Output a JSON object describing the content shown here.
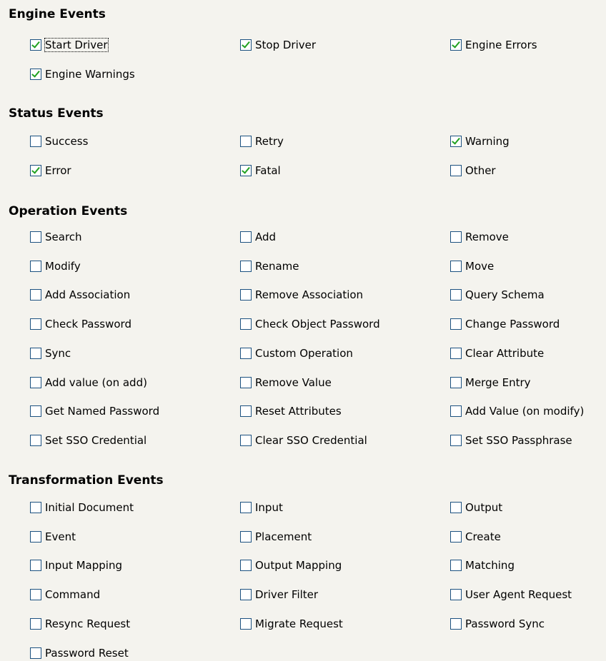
{
  "sections": [
    {
      "title": "Engine Events",
      "items": [
        {
          "label": "Start Driver",
          "checked": true
        },
        {
          "label": "Stop Driver",
          "checked": true
        },
        {
          "label": "Engine Errors",
          "checked": true
        },
        {
          "label": "Engine Warnings",
          "checked": true
        }
      ]
    },
    {
      "title": "Status Events",
      "items": [
        {
          "label": "Success",
          "checked": false
        },
        {
          "label": "Retry",
          "checked": false
        },
        {
          "label": "Warning",
          "checked": true
        },
        {
          "label": "Error",
          "checked": true
        },
        {
          "label": "Fatal",
          "checked": true
        },
        {
          "label": "Other",
          "checked": false
        }
      ]
    },
    {
      "title": "Operation Events",
      "items": [
        {
          "label": "Search",
          "checked": false
        },
        {
          "label": "Add",
          "checked": false
        },
        {
          "label": "Remove",
          "checked": false
        },
        {
          "label": "Modify",
          "checked": false
        },
        {
          "label": "Rename",
          "checked": false
        },
        {
          "label": "Move",
          "checked": false
        },
        {
          "label": "Add Association",
          "checked": false
        },
        {
          "label": "Remove Association",
          "checked": false
        },
        {
          "label": "Query Schema",
          "checked": false
        },
        {
          "label": "Check Password",
          "checked": false
        },
        {
          "label": "Check Object Password",
          "checked": false
        },
        {
          "label": "Change Password",
          "checked": false
        },
        {
          "label": "Sync",
          "checked": false
        },
        {
          "label": "Custom Operation",
          "checked": false
        },
        {
          "label": "Clear Attribute",
          "checked": false
        },
        {
          "label": "Add value (on add)",
          "checked": false
        },
        {
          "label": "Remove Value",
          "checked": false
        },
        {
          "label": "Merge Entry",
          "checked": false
        },
        {
          "label": "Get Named Password",
          "checked": false
        },
        {
          "label": "Reset Attributes",
          "checked": false
        },
        {
          "label": "Add Value (on modify)",
          "checked": false
        },
        {
          "label": "Set SSO Credential",
          "checked": false
        },
        {
          "label": "Clear SSO Credential",
          "checked": false
        },
        {
          "label": "Set SSO Passphrase",
          "checked": false
        }
      ]
    },
    {
      "title": "Transformation Events",
      "items": [
        {
          "label": "Initial Document",
          "checked": false
        },
        {
          "label": "Input",
          "checked": false
        },
        {
          "label": "Output",
          "checked": false
        },
        {
          "label": "Event",
          "checked": false
        },
        {
          "label": "Placement",
          "checked": false
        },
        {
          "label": "Create",
          "checked": false
        },
        {
          "label": "Input Mapping",
          "checked": false
        },
        {
          "label": "Output Mapping",
          "checked": false
        },
        {
          "label": "Matching",
          "checked": false
        },
        {
          "label": "Command",
          "checked": false
        },
        {
          "label": "Driver Filter",
          "checked": false
        },
        {
          "label": "User Agent Request",
          "checked": false
        },
        {
          "label": "Resync Request",
          "checked": false
        },
        {
          "label": "Migrate Request",
          "checked": false
        },
        {
          "label": "Password Sync",
          "checked": false
        },
        {
          "label": "Password Reset",
          "checked": false
        }
      ]
    }
  ],
  "colors": {
    "background": "#f4f3ee",
    "checkbox_border": "#1c5180",
    "checkmark": "#21a121"
  }
}
